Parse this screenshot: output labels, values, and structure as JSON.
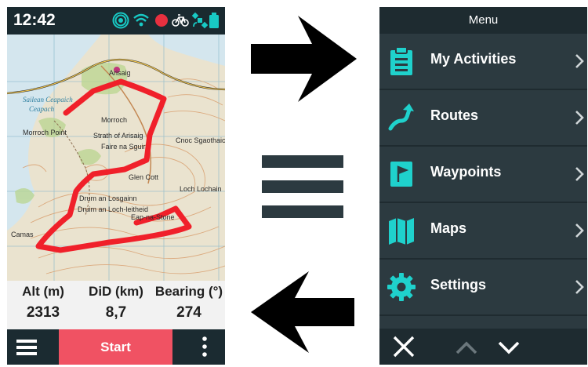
{
  "status_bar": {
    "time": "12:42",
    "icons": [
      "signal-icon",
      "wifi-icon",
      "recording-dot-icon",
      "bike-icon",
      "satellite-icon",
      "battery-icon"
    ],
    "recording_color": "#e8303f",
    "accent_color": "#18c9c4"
  },
  "map": {
    "place_labels": [
      "Arisaig",
      "Morroch",
      "Strath of Arisaig",
      "Faire na Sguir",
      "Glen Cott",
      "Drum an Losgainn",
      "Cnoc Sgaothaich",
      "Druim an Loch-leitheid",
      "Eap-na-Stone",
      "Loch Lochain",
      "Morroch Point",
      "Camas"
    ],
    "water_labels": [
      "Sailean Ceapaich",
      "Ceapach"
    ],
    "route_color": "#f0202a"
  },
  "data_fields": [
    {
      "label": "Alt (m)",
      "value": "2313"
    },
    {
      "label": "DiD (km)",
      "value": "8,7"
    },
    {
      "label": "Bearing (°)",
      "value": "274"
    }
  ],
  "bottom_bar": {
    "start_label": "Start",
    "start_color": "#f05263"
  },
  "menu": {
    "title": "Menu",
    "items": [
      {
        "label": "My Activities",
        "icon": "clipboard-icon"
      },
      {
        "label": "Routes",
        "icon": "route-icon"
      },
      {
        "label": "Waypoints",
        "icon": "waypoint-flag-icon"
      },
      {
        "label": "Maps",
        "icon": "map-icon"
      },
      {
        "label": "Settings",
        "icon": "gear-icon"
      }
    ],
    "icon_color": "#1fd1cc"
  }
}
